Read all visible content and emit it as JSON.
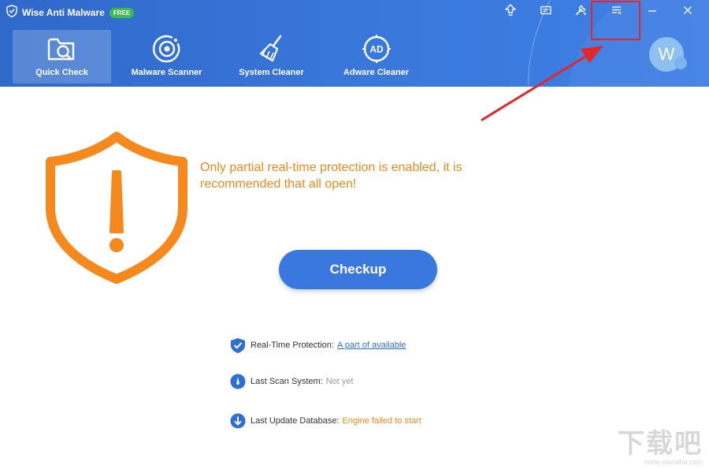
{
  "app": {
    "title": "Wise Anti Malware",
    "badge": "FREE"
  },
  "nav": {
    "items": [
      {
        "label": "Quick Check",
        "icon": "quick-check-icon",
        "active": true
      },
      {
        "label": "Malware Scanner",
        "icon": "malware-scanner-icon",
        "active": false
      },
      {
        "label": "System Cleaner",
        "icon": "broom-icon",
        "active": false
      },
      {
        "label": "Adware Cleaner",
        "icon": "adware-icon",
        "adware_text": "AD",
        "active": false
      }
    ]
  },
  "toolbar": {
    "icons": [
      "upgrade-icon",
      "feedback-icon",
      "tools-icon",
      "menu-icon",
      "minimize-icon",
      "close-icon"
    ]
  },
  "avatar": {
    "initial": "W"
  },
  "warning": {
    "text": "Only partial real-time protection is enabled, it is recommended that all open!"
  },
  "checkup": {
    "label": "Checkup"
  },
  "status": [
    {
      "label": "Real-Time Protection:",
      "value": "A part of available",
      "icon": "shield-check-icon"
    },
    {
      "label": "Last Scan System:",
      "value": "Not yet",
      "icon": "scan-dial-icon"
    },
    {
      "label": "Last Update Database:",
      "value": "Engine failed to start",
      "icon": "download-arrow-icon"
    }
  ],
  "watermark": {
    "text": "下载吧",
    "sub": "www.xiazaiba.com"
  },
  "colors": {
    "header": "#3a78dc",
    "accent": "#3a78e0",
    "warning": "#ea8a1c",
    "shield": "#f5891d",
    "highlight": "#e4262b"
  }
}
